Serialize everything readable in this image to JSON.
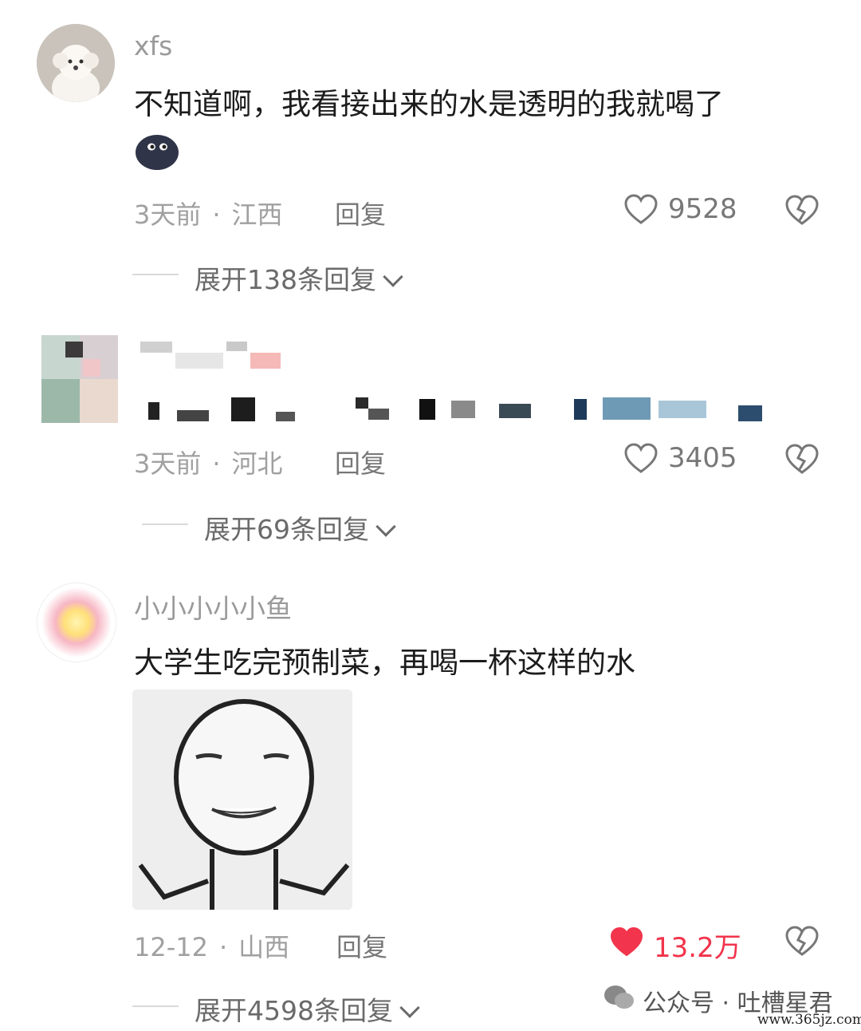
{
  "comments": [
    {
      "username": "xfs",
      "text": "不知道啊，我看接出来的水是透明的我就喝了",
      "emoji": "dark-blob-emoji",
      "time": "3天前",
      "location": "江西",
      "reply_label": "回复",
      "likes": "9528",
      "liked": false,
      "expand_label": "展开138条回复"
    },
    {
      "username": "",
      "text": "",
      "time": "3天前",
      "location": "河北",
      "reply_label": "回复",
      "likes": "3405",
      "liked": false,
      "expand_label": "展开69条回复",
      "pixelated": true
    },
    {
      "username": "小小小小小鱼",
      "text": "大学生吃完预制菜，再喝一杯这样的水",
      "sticker": "smiling-face-sticker",
      "time": "12-12",
      "location": "山西",
      "reply_label": "回复",
      "likes": "13.2万",
      "liked": true,
      "expand_label": "展开4598条回复"
    }
  ],
  "meta_separator": "·",
  "watermark": {
    "label": "公众号 · 吐槽星君",
    "url": "www.365jz.com"
  },
  "colors": {
    "like_active": "#f2344c",
    "muted": "#a0a0a0"
  }
}
